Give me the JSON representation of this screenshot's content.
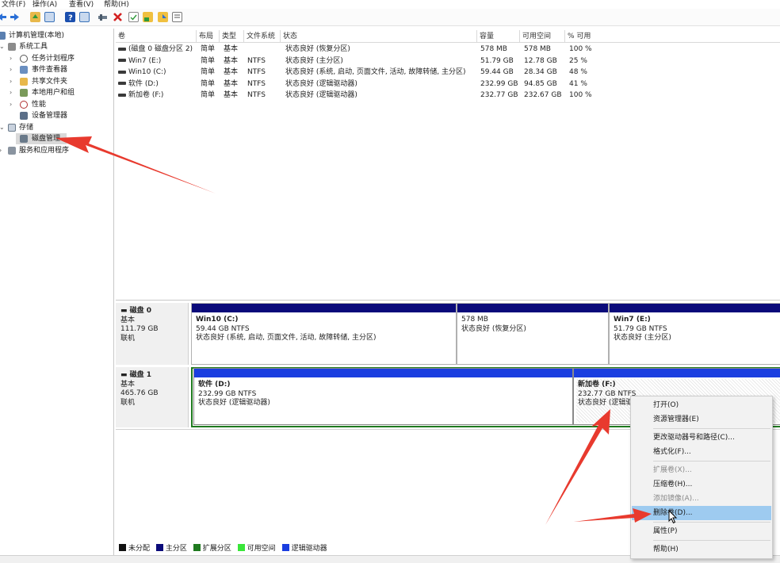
{
  "menubar": {
    "items": [
      "文件(F)",
      "操作(A)",
      "查看(V)",
      "帮助(H)"
    ]
  },
  "toolbar": {
    "icons": [
      "back-arrow-icon",
      "forward-arrow-icon",
      "up-folder-icon",
      "console-tree-icon",
      "help-icon",
      "properties-icon",
      "connect-icon",
      "delete-icon",
      "check-icon",
      "new-icon",
      "folder-open-icon",
      "view-icon"
    ]
  },
  "tree": {
    "root": "计算机管理(本地)",
    "system_tools": "系统工具",
    "task_scheduler": "任务计划程序",
    "event_viewer": "事件查看器",
    "shared_folders": "共享文件夹",
    "local_users": "本地用户和组",
    "performance": "性能",
    "device_manager": "设备管理器",
    "storage": "存储",
    "disk_management": "磁盘管理",
    "services_apps": "服务和应用程序"
  },
  "volumes": {
    "headers": [
      "卷",
      "布局",
      "类型",
      "文件系统",
      "状态",
      "容量",
      "可用空间",
      "% 可用"
    ],
    "rows": [
      [
        "(磁盘 0 磁盘分区 2)",
        "简单",
        "基本",
        "",
        "状态良好 (恢复分区)",
        "578 MB",
        "578 MB",
        "100 %"
      ],
      [
        "Win7 (E:)",
        "简单",
        "基本",
        "NTFS",
        "状态良好 (主分区)",
        "51.79 GB",
        "12.78 GB",
        "25 %"
      ],
      [
        "Win10 (C:)",
        "简单",
        "基本",
        "NTFS",
        "状态良好 (系统, 启动, 页面文件, 活动, 故障转储, 主分区)",
        "59.44 GB",
        "28.34 GB",
        "48 %"
      ],
      [
        "软件 (D:)",
        "简单",
        "基本",
        "NTFS",
        "状态良好 (逻辑驱动器)",
        "232.99 GB",
        "94.85 GB",
        "41 %"
      ],
      [
        "新加卷 (F:)",
        "简单",
        "基本",
        "NTFS",
        "状态良好 (逻辑驱动器)",
        "232.77 GB",
        "232.67 GB",
        "100 %"
      ]
    ]
  },
  "disks": [
    {
      "name": "磁盘 0",
      "type": "基本",
      "size": "111.79 GB",
      "state": "联机",
      "partitions": [
        {
          "title": "Win10  (C:)",
          "size": "59.44 GB NTFS",
          "status": "状态良好 (系统, 启动, 页面文件, 活动, 故障转储, 主分区)"
        },
        {
          "title": "",
          "size": "578 MB",
          "status": "状态良好 (恢复分区)"
        },
        {
          "title": "Win7  (E:)",
          "size": "51.79 GB NTFS",
          "status": "状态良好 (主分区)"
        }
      ]
    },
    {
      "name": "磁盘 1",
      "type": "基本",
      "size": "465.76 GB",
      "state": "联机",
      "partitions": [
        {
          "title": "软件  (D:)",
          "size": "232.99 GB NTFS",
          "status": "状态良好 (逻辑驱动器)"
        },
        {
          "title": "新加卷  (F:)",
          "size": "232.77 GB NTFS",
          "status": "状态良好 (逻辑驱"
        }
      ]
    }
  ],
  "legend": [
    "未分配",
    "主分区",
    "扩展分区",
    "可用空间",
    "逻辑驱动器"
  ],
  "colors": {
    "primary_partition": "#0a0a7a",
    "logical_drive": "#1a3ee0",
    "extended_partition": "#1f7a1f",
    "free_space": "#39e639",
    "unallocated": "#111111",
    "menu_highlight": "#9ecbf0",
    "annotation_arrow": "#e83a2e"
  },
  "context_menu": {
    "items": [
      {
        "label": "打开(O)",
        "enabled": true
      },
      {
        "label": "资源管理器(E)",
        "enabled": true
      },
      {
        "label": "更改驱动器号和路径(C)...",
        "enabled": true
      },
      {
        "label": "格式化(F)...",
        "enabled": true
      },
      {
        "label": "扩展卷(X)...",
        "enabled": false
      },
      {
        "label": "压缩卷(H)...",
        "enabled": true
      },
      {
        "label": "添加镜像(A)...",
        "enabled": false
      },
      {
        "label": "删除卷(D)...",
        "enabled": true,
        "highlighted": true
      },
      {
        "label": "属性(P)",
        "enabled": true
      },
      {
        "label": "帮助(H)",
        "enabled": true
      }
    ]
  }
}
